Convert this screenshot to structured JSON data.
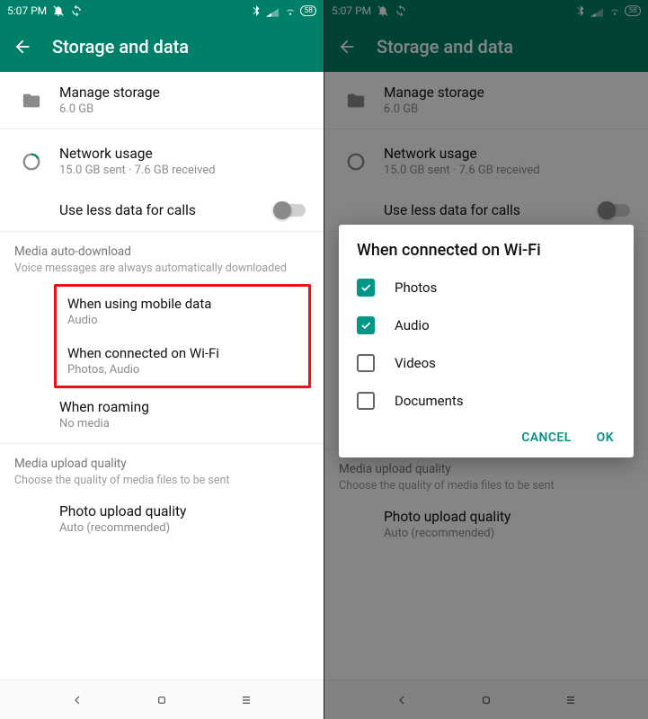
{
  "status": {
    "time": "5:07 PM",
    "battery": "58"
  },
  "appbar": {
    "title": "Storage and data"
  },
  "manage": {
    "title": "Manage storage",
    "sub": "6.0 GB"
  },
  "network": {
    "title": "Network usage",
    "sub": "15.0 GB sent · 7.6 GB received"
  },
  "lessdata": {
    "title": "Use less data for calls"
  },
  "media_section": {
    "title": "Media auto-download",
    "sub": "Voice messages are always automatically downloaded"
  },
  "mobile": {
    "title": "When using mobile data",
    "sub": "Audio"
  },
  "wifi": {
    "title": "When connected on Wi-Fi",
    "sub": "Photos, Audio"
  },
  "roam": {
    "title": "When roaming",
    "sub": "No media"
  },
  "upload_section": {
    "title": "Media upload quality",
    "sub": "Choose the quality of media files to be sent"
  },
  "photo": {
    "title": "Photo upload quality",
    "sub": "Auto (recommended)"
  },
  "dialog": {
    "title": "When connected on Wi-Fi",
    "opt1": "Photos",
    "opt2": "Audio",
    "opt3": "Videos",
    "opt4": "Documents",
    "cancel": "CANCEL",
    "ok": "OK"
  }
}
